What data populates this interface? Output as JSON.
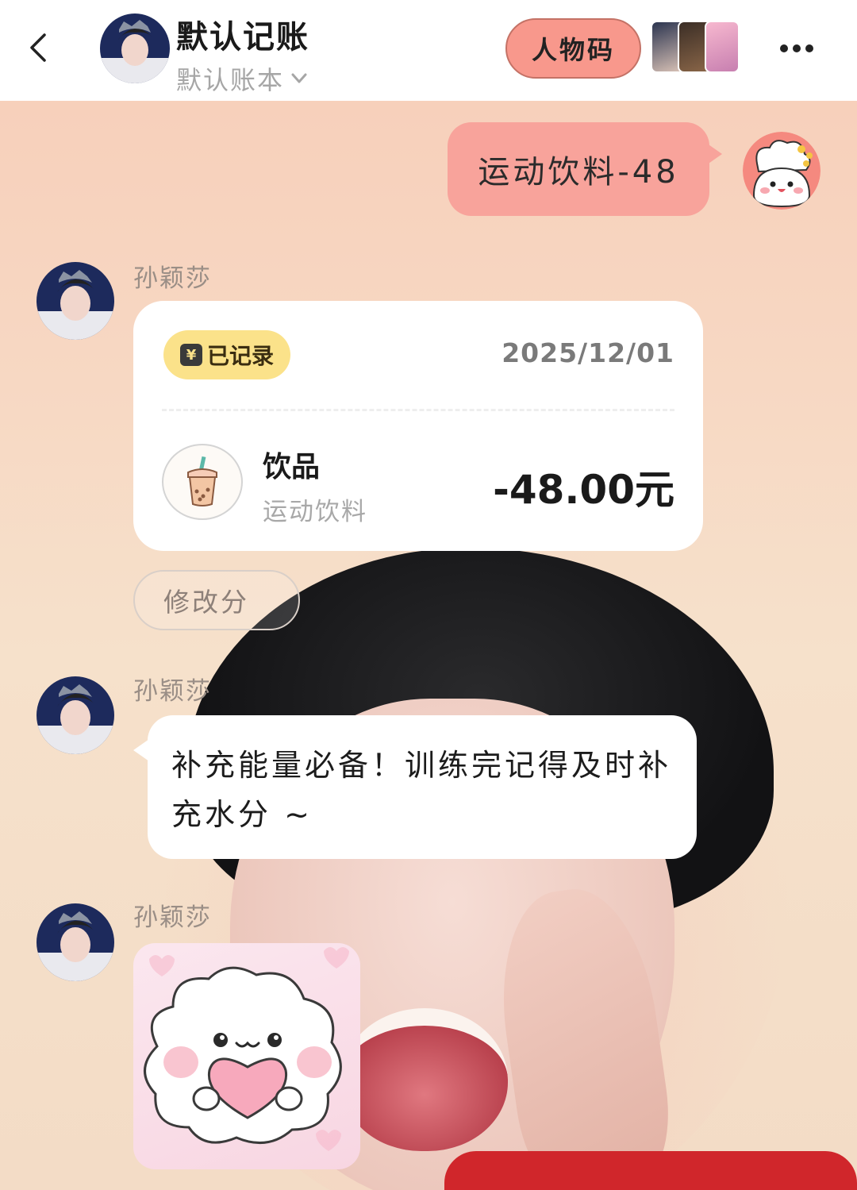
{
  "header": {
    "title": "默认记账",
    "subtitle": "默认账本",
    "character_code_label": "人物码",
    "more_label": "•••"
  },
  "chat": {
    "my_message": "运动饮料-48",
    "sender_name": "孙颖莎",
    "record_card": {
      "status_label": "已记录",
      "status_icon_glyph": "¥",
      "date": "2025/12/01",
      "category": "饮品",
      "note": "运动饮料",
      "amount": "-48.00元"
    },
    "edit_button_label": "修改分",
    "reply_text": "补充能量必备！训练完记得及时补充水分 ~"
  },
  "colors": {
    "my_bubble": "#f8a39b",
    "char_code_button": "#f8988c",
    "status_badge": "#fbe28a",
    "sender_name": "#9a8e86"
  },
  "icons": [
    "back-arrow-icon",
    "chevron-down-icon",
    "more-icon",
    "bubble-tea-icon",
    "yen-icon",
    "chef-mascot-icon",
    "cloud-heart-sticker"
  ]
}
